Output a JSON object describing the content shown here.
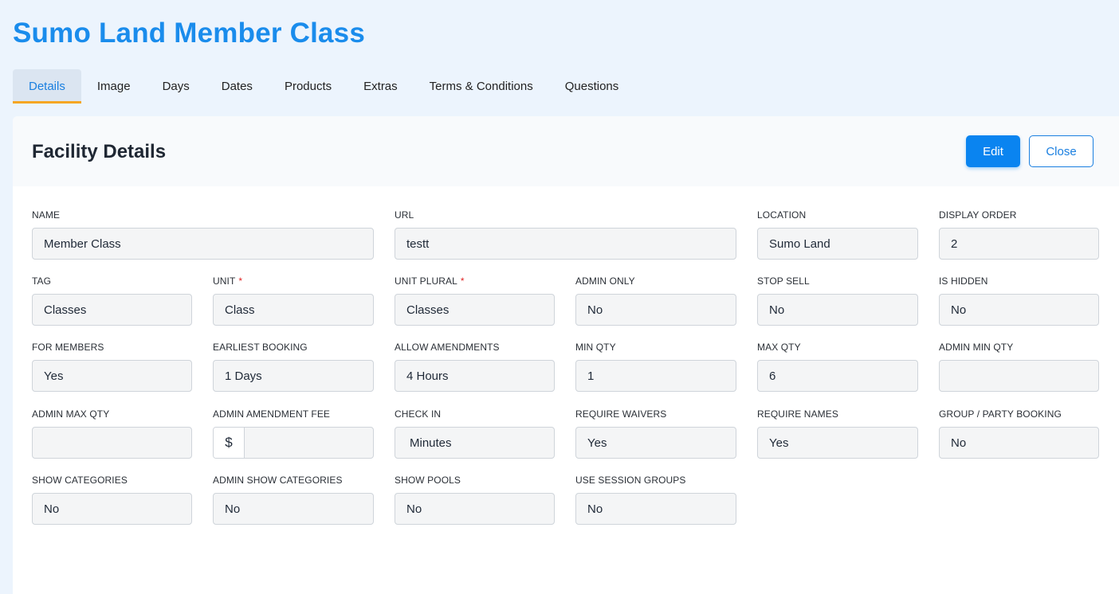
{
  "page": {
    "title": "Sumo Land Member Class"
  },
  "tabs": [
    {
      "label": "Details",
      "active": true
    },
    {
      "label": "Image"
    },
    {
      "label": "Days"
    },
    {
      "label": "Dates"
    },
    {
      "label": "Products"
    },
    {
      "label": "Extras"
    },
    {
      "label": "Terms & Conditions"
    },
    {
      "label": "Questions"
    }
  ],
  "card": {
    "title": "Facility Details",
    "edit_label": "Edit",
    "close_label": "Close"
  },
  "fields": {
    "name": {
      "label": "NAME",
      "value": "Member Class"
    },
    "url": {
      "label": "URL",
      "value": "testt"
    },
    "location": {
      "label": "LOCATION",
      "value": "Sumo Land"
    },
    "display_order": {
      "label": "DISPLAY ORDER",
      "value": "2"
    },
    "tag": {
      "label": "TAG",
      "value": "Classes"
    },
    "unit": {
      "label": "UNIT",
      "value": "Class",
      "required": "*"
    },
    "unit_plural": {
      "label": "UNIT PLURAL",
      "value": "Classes",
      "required": "*"
    },
    "admin_only": {
      "label": "ADMIN ONLY",
      "value": "No"
    },
    "stop_sell": {
      "label": "STOP SELL",
      "value": "No"
    },
    "is_hidden": {
      "label": "IS HIDDEN",
      "value": "No"
    },
    "for_members": {
      "label": "FOR MEMBERS",
      "value": "Yes"
    },
    "earliest_booking": {
      "label": "EARLIEST BOOKING",
      "value": "1 Days"
    },
    "allow_amendments": {
      "label": "ALLOW AMENDMENTS",
      "value": "4 Hours"
    },
    "min_qty": {
      "label": "MIN QTY",
      "value": "1"
    },
    "max_qty": {
      "label": "MAX QTY",
      "value": "6"
    },
    "admin_min_qty": {
      "label": "ADMIN MIN QTY",
      "value": ""
    },
    "admin_max_qty": {
      "label": "ADMIN MAX QTY",
      "value": ""
    },
    "admin_amendment_fee": {
      "label": "ADMIN AMENDMENT FEE",
      "prefix": "$",
      "value": ""
    },
    "check_in": {
      "label": "CHECK IN",
      "value": "Minutes"
    },
    "require_waivers": {
      "label": "REQUIRE WAIVERS",
      "value": "Yes"
    },
    "require_names": {
      "label": "REQUIRE NAMES",
      "value": "Yes"
    },
    "group_party_booking": {
      "label": "GROUP / PARTY BOOKING",
      "value": "No"
    },
    "show_categories": {
      "label": "SHOW CATEGORIES",
      "value": "No"
    },
    "admin_show_categories": {
      "label": "ADMIN SHOW CATEGORIES",
      "value": "No"
    },
    "show_pools": {
      "label": "SHOW POOLS",
      "value": "No"
    },
    "use_session_groups": {
      "label": "USE SESSION GROUPS",
      "value": "No"
    }
  }
}
